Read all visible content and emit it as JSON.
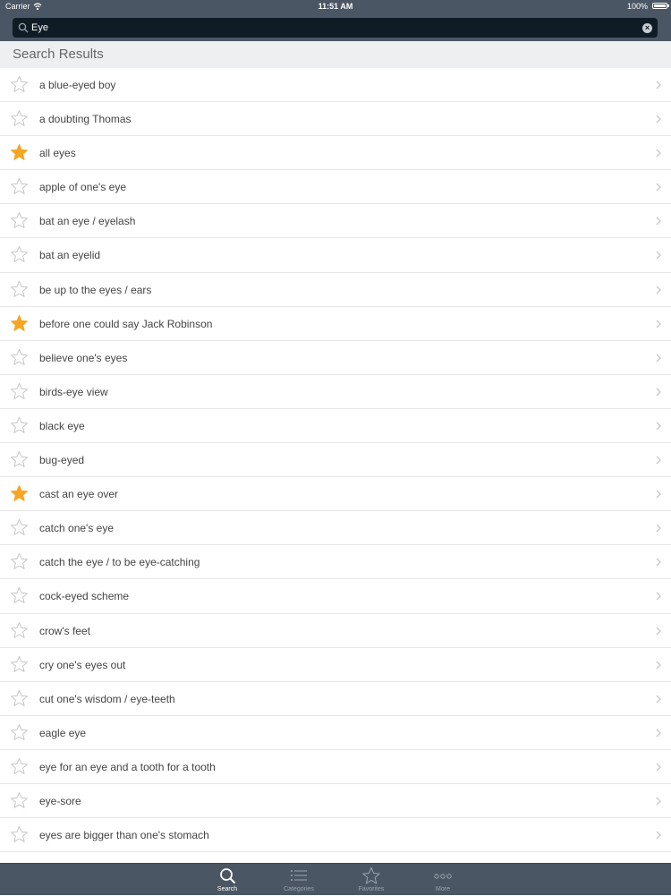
{
  "status_bar": {
    "carrier": "Carrier",
    "time": "11:51 AM",
    "battery": "100%"
  },
  "search": {
    "value": "Eye",
    "placeholder": ""
  },
  "section_header": "Search Results",
  "colors": {
    "bar_background": "#4a5663",
    "search_field": "#0f1c26",
    "star_favorite": "#f5a623",
    "star_outline": "#c7c7cc"
  },
  "results": [
    {
      "label": "a blue-eyed boy",
      "favorite": false
    },
    {
      "label": "a doubting Thomas",
      "favorite": false
    },
    {
      "label": "all eyes",
      "favorite": true
    },
    {
      "label": "apple of one's eye",
      "favorite": false
    },
    {
      "label": "bat an eye / eyelash",
      "favorite": false
    },
    {
      "label": "bat an eyelid",
      "favorite": false
    },
    {
      "label": "be up to the eyes / ears",
      "favorite": false
    },
    {
      "label": "before one could say Jack Robinson",
      "favorite": true
    },
    {
      "label": "believe one's eyes",
      "favorite": false
    },
    {
      "label": "birds-eye view",
      "favorite": false
    },
    {
      "label": "black eye",
      "favorite": false
    },
    {
      "label": "bug-eyed",
      "favorite": false
    },
    {
      "label": "cast an eye over",
      "favorite": true
    },
    {
      "label": "catch one's eye",
      "favorite": false
    },
    {
      "label": "catch the eye / to be eye-catching",
      "favorite": false
    },
    {
      "label": "cock-eyed scheme",
      "favorite": false
    },
    {
      "label": "crow's feet",
      "favorite": false
    },
    {
      "label": "cry one's eyes out",
      "favorite": false
    },
    {
      "label": "cut one's wisdom / eye-teeth",
      "favorite": false
    },
    {
      "label": "eagle eye",
      "favorite": false
    },
    {
      "label": "eye for an eye and a tooth for a tooth",
      "favorite": false
    },
    {
      "label": "eye-sore",
      "favorite": false
    },
    {
      "label": "eyes are bigger than one's stomach",
      "favorite": false
    }
  ],
  "tabs": [
    {
      "label": "Search",
      "icon": "search-icon",
      "active": true
    },
    {
      "label": "Categories",
      "icon": "list-icon",
      "active": false
    },
    {
      "label": "Favorites",
      "icon": "star-icon",
      "active": false
    },
    {
      "label": "More",
      "icon": "more-icon",
      "active": false
    }
  ]
}
